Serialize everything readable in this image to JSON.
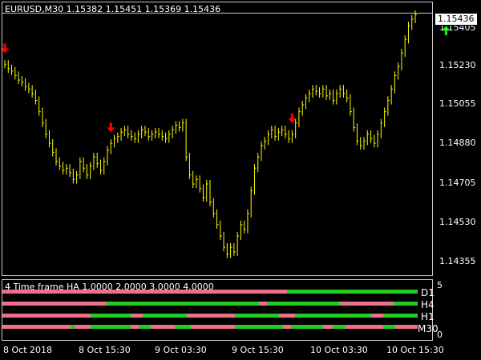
{
  "header": {
    "title": "EURUSD,M30  1.15382 1.15451 1.15369 1.15436"
  },
  "price_axis": {
    "ticks": [
      "1.15405",
      "1.15230",
      "1.15055",
      "1.14880",
      "1.14705",
      "1.14530",
      "1.14355"
    ],
    "current": "1.15436"
  },
  "indicator": {
    "title": "4 Time frame HA 1.0000 2.0000 3.0000 4.0000",
    "axis_ticks": [
      "5",
      "0"
    ],
    "rows": [
      {
        "label": "D1"
      },
      {
        "label": "H4"
      },
      {
        "label": "H1"
      },
      {
        "label": "M30"
      }
    ]
  },
  "time_axis": {
    "ticks": [
      "8 Oct 2018",
      "8 Oct 15:30",
      "9 Oct 03:30",
      "9 Oct 15:30",
      "10 Oct 03:30",
      "10 Oct 15:30"
    ]
  },
  "colors": {
    "bars": "#ffff00",
    "arrow_down": "#ff0000",
    "arrow_up": "#00ff00",
    "bull": "#22cc22",
    "bear": "#ee6f8a",
    "grid": "#c8c8c8"
  },
  "chart_data": {
    "type": "line",
    "title": "EURUSD,M30  1.15382 1.15451 1.15369 1.15436",
    "xlabel": "",
    "ylabel": "",
    "ylim": [
      1.1428,
      1.1548
    ],
    "x": [
      "8 Oct 2018",
      "",
      "",
      "",
      "",
      "",
      "",
      "",
      "",
      "",
      "",
      "",
      "",
      "",
      "",
      "",
      "",
      "8 Oct 15:30",
      "",
      "",
      "",
      "",
      "",
      "",
      "",
      "",
      "",
      "",
      "",
      "",
      "",
      "",
      "",
      "",
      "",
      "",
      "",
      "",
      "",
      "",
      "",
      "",
      "",
      "9 Oct 03:30",
      "",
      "",
      "",
      "",
      "",
      "",
      "",
      "",
      "",
      "",
      "",
      "",
      "",
      "",
      "",
      "",
      "",
      "",
      "",
      "",
      "",
      "",
      "",
      "",
      "",
      "9 Oct 15:30",
      "",
      "",
      "",
      "",
      "",
      "",
      "",
      "",
      "",
      "",
      "",
      "",
      "",
      "",
      "",
      "",
      "",
      "",
      "",
      "",
      "",
      "",
      "",
      "",
      "",
      "10 Oct 03:30",
      "",
      "",
      "",
      "",
      "",
      "",
      "",
      "",
      "",
      "",
      "",
      "",
      "",
      "",
      "",
      "",
      "",
      "",
      "",
      "",
      "",
      "",
      "",
      "",
      "10 Oct 15:30",
      "",
      "",
      "",
      "",
      "",
      "",
      "",
      "",
      "",
      ""
    ],
    "series": [
      {
        "values": [
          1.1521,
          1.1519,
          1.1518,
          1.1516,
          1.1514,
          1.1513,
          1.1511,
          1.151,
          1.1508,
          1.1505,
          1.15,
          1.1495,
          1.149,
          1.1486,
          1.1482,
          1.1478,
          1.1476,
          1.1474,
          1.1475,
          1.1473,
          1.147,
          1.1472,
          1.1478,
          1.1475,
          1.1472,
          1.1476,
          1.148,
          1.1477,
          1.1474,
          1.1478,
          1.1483,
          1.1486,
          1.1488,
          1.1489,
          1.1491,
          1.1492,
          1.149,
          1.1489,
          1.1488,
          1.149,
          1.1492,
          1.1491,
          1.1489,
          1.149,
          1.1491,
          1.149,
          1.1489,
          1.1488,
          1.149,
          1.1492,
          1.1494,
          1.1493,
          1.1495,
          1.148,
          1.1472,
          1.1468,
          1.147,
          1.1466,
          1.1462,
          1.1468,
          1.146,
          1.1455,
          1.145,
          1.1445,
          1.144,
          1.1437,
          1.144,
          1.1438,
          1.1445,
          1.145,
          1.1448,
          1.1455,
          1.1465,
          1.1475,
          1.148,
          1.1485,
          1.1487,
          1.149,
          1.1492,
          1.1489,
          1.1491,
          1.1492,
          1.149,
          1.1488,
          1.149,
          1.1495,
          1.15,
          1.1503,
          1.1506,
          1.1508,
          1.151,
          1.1509,
          1.1508,
          1.151,
          1.1507,
          1.1508,
          1.1505,
          1.1508,
          1.151,
          1.1508,
          1.1506,
          1.15,
          1.1493,
          1.1487,
          1.1485,
          1.1487,
          1.149,
          1.1488,
          1.1486,
          1.149,
          1.1495,
          1.15,
          1.1505,
          1.151,
          1.1516,
          1.152,
          1.1526,
          1.1532,
          1.1538,
          1.1541,
          1.1543
        ],
        "line_position": 1.15436
      }
    ],
    "signals": {
      "down": [
        0,
        31,
        84
      ],
      "up": [
        129,
        147,
        173
      ]
    }
  }
}
